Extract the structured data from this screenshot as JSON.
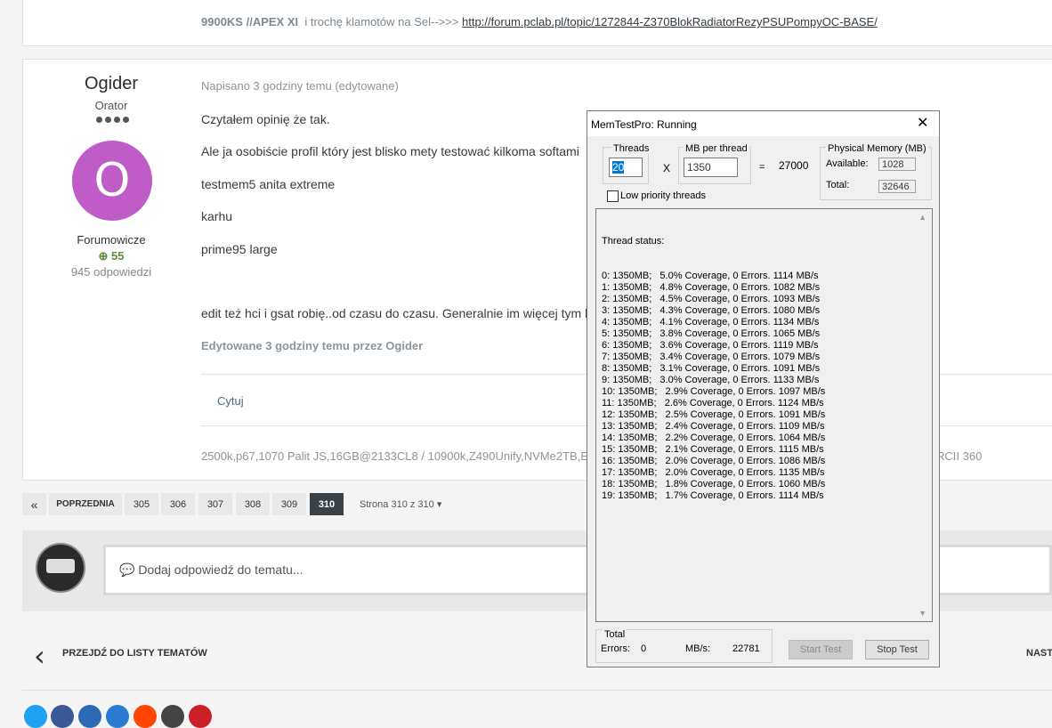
{
  "top_signature": {
    "bold": "9900KS //APEX XI",
    "text": "i  trochę klamotów na Sel-->>> ",
    "link": "http://forum.pclab.pl/topic/1272844-Z370BlokRadiatorRezyPSUPompyOC-BASE/"
  },
  "author": {
    "name": "Ogider",
    "rank": "Orator",
    "avatar_letter": "O",
    "group": "Forumowicze",
    "reputation": "55",
    "post_count": "945 odpowiedzi"
  },
  "post": {
    "posted": "Napisano 3 godziny temu (edytowane)",
    "lines": [
      "Czytałem opinię że tak.",
      "Ale ja osobiście profil który jest blisko mety testować kilkoma softami",
      "testmem5 anita extreme",
      "karhu",
      "prime95 large",
      "edit też hci i gsat robię..od czasu do czasu. Generalnie im więcej tym le"
    ],
    "edited": "Edytowane 3 godziny temu przez Ogider",
    "quote": "Cytuj",
    "signature": "2500k,p67,1070 Palit JS,16GB@2133CL8 / 10900k,Z490Unify,NVMe2TB,EV",
    "signature_right": "RCII 360"
  },
  "pagination": {
    "prev_icon": "«",
    "prev": "POPRZEDNIA",
    "pages": [
      "305",
      "306",
      "307",
      "308",
      "309",
      "310"
    ],
    "active": "310",
    "info": "Strona 310 z 310"
  },
  "reply": {
    "placeholder": "Dodaj odpowiedź do tematu..."
  },
  "nav": {
    "back": "PRZEJDŹ DO LISTY TEMATÓW",
    "next": "NAST"
  },
  "share_colors": [
    "#1da1f2",
    "#3b5998",
    "#2b6bb5",
    "#2c7cd3",
    "#ff4500",
    "#444444",
    "#cb2027"
  ],
  "memtest": {
    "title": "MemTestPro: Running",
    "threads_label": "Threads",
    "threads_value": "20",
    "mb_label": "MB per thread",
    "mb_value": "1350",
    "times": "X",
    "equals": "=",
    "total_value": "27000",
    "phys_label": "Physical Memory (MB)",
    "available_label": "Available:",
    "available_value": "1028",
    "total_label": "Total:",
    "total_mem_value": "32646",
    "low_priority": "Low priority threads",
    "status_title": "Thread status:",
    "threads": [
      "0: 1350MB;   5.0% Coverage, 0 Errors. 1114 MB/s",
      "1: 1350MB;   4.8% Coverage, 0 Errors. 1082 MB/s",
      "2: 1350MB;   4.5% Coverage, 0 Errors. 1093 MB/s",
      "3: 1350MB;   4.3% Coverage, 0 Errors. 1080 MB/s",
      "4: 1350MB;   4.1% Coverage, 0 Errors. 1134 MB/s",
      "5: 1350MB;   3.8% Coverage, 0 Errors. 1065 MB/s",
      "6: 1350MB;   3.6% Coverage, 0 Errors. 1119 MB/s",
      "7: 1350MB;   3.4% Coverage, 0 Errors. 1079 MB/s",
      "8: 1350MB;   3.1% Coverage, 0 Errors. 1091 MB/s",
      "9: 1350MB;   3.0% Coverage, 0 Errors. 1133 MB/s",
      "10: 1350MB;   2.9% Coverage, 0 Errors. 1097 MB/s",
      "11: 1350MB;   2.6% Coverage, 0 Errors. 1124 MB/s",
      "12: 1350MB;   2.5% Coverage, 0 Errors. 1091 MB/s",
      "13: 1350MB;   2.4% Coverage, 0 Errors. 1109 MB/s",
      "14: 1350MB;   2.2% Coverage, 0 Errors. 1064 MB/s",
      "15: 1350MB;   2.1% Coverage, 0 Errors. 1115 MB/s",
      "16: 1350MB;   2.0% Coverage, 0 Errors. 1086 MB/s",
      "17: 1350MB;   2.0% Coverage, 0 Errors. 1135 MB/s",
      "18: 1350MB;   1.8% Coverage, 0 Errors. 1060 MB/s",
      "19: 1350MB;   1.7% Coverage, 0 Errors. 1114 MB/s"
    ],
    "total_group": "Total",
    "errors_label": "Errors:",
    "errors_value": "0",
    "mbs_label": "MB/s:",
    "mbs_value": "22781",
    "start": "Start Test",
    "stop": "Stop Test"
  }
}
